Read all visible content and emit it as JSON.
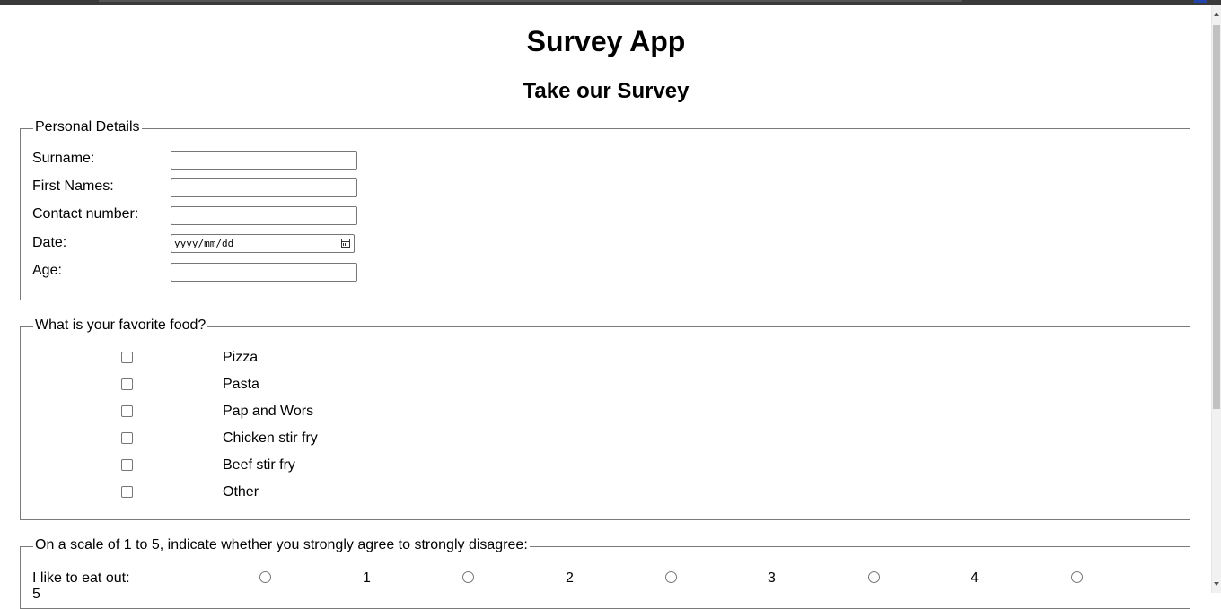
{
  "page": {
    "title": "Survey App",
    "subtitle": "Take our Survey"
  },
  "personal_details": {
    "legend": "Personal Details",
    "fields": [
      {
        "label": "Surname:",
        "value": ""
      },
      {
        "label": "First Names:",
        "value": ""
      },
      {
        "label": "Contact number:",
        "value": ""
      },
      {
        "label": "Date:",
        "value": "",
        "placeholder": "yyyy/mm/dd"
      },
      {
        "label": "Age:",
        "value": ""
      }
    ]
  },
  "favorite_food": {
    "legend": "What is your favorite food?",
    "options": [
      {
        "label": "Pizza",
        "checked": false
      },
      {
        "label": "Pasta",
        "checked": false
      },
      {
        "label": "Pap and Wors",
        "checked": false
      },
      {
        "label": "Chicken stir fry",
        "checked": false
      },
      {
        "label": "Beef stir fry",
        "checked": false
      },
      {
        "label": "Other",
        "checked": false
      }
    ]
  },
  "rating": {
    "legend": "On a scale of 1 to 5, indicate whether you strongly agree to strongly disagree:",
    "rows": [
      {
        "label": "I like to eat out:",
        "scale": [
          "1",
          "2",
          "3",
          "4",
          "5"
        ]
      }
    ]
  }
}
